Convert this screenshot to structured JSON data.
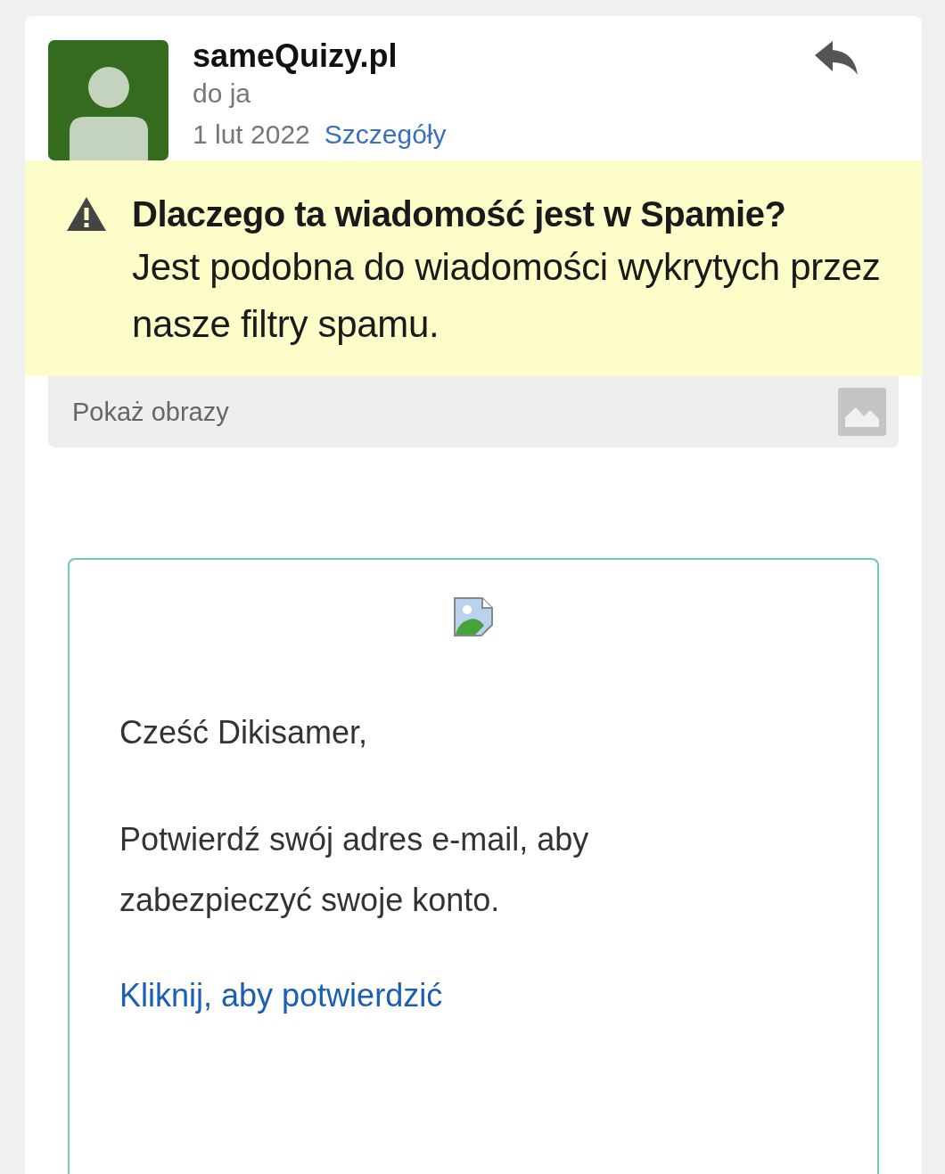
{
  "sender": {
    "name": "sameQuizy.pl",
    "recipient": "do ja",
    "date": "1 lut 2022",
    "details_link": "Szczegóły"
  },
  "spam_warning": {
    "title": "Dlaczego ta wiadomość jest w Spamie?",
    "text": "Jest podobna do wiadomości wykrytych przez nasze filtry spamu."
  },
  "show_images": {
    "label": "Pokaż obrazy"
  },
  "message": {
    "paragraphs": [
      {
        "kind": "text",
        "text": "Cześć Dikisamer,"
      },
      {
        "kind": "text",
        "text": "Potwierdź swój adres e-mail, aby zabezpieczyć swoje konto."
      },
      {
        "kind": "link",
        "text": "Kliknij, aby potwierdzić"
      }
    ]
  }
}
